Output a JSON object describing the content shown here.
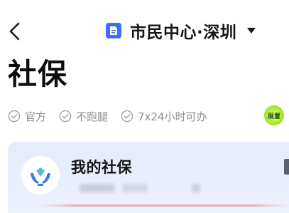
{
  "header": {
    "back_icon": "chevron-left-icon",
    "location_icon": "citizen-center-doc-icon",
    "location_label": "市民中心·深圳",
    "dropdown_icon": "caret-down-icon"
  },
  "page": {
    "title": "社保"
  },
  "features": [
    {
      "icon": "check-circle-icon",
      "label": "官方"
    },
    {
      "icon": "check-circle-icon",
      "label": "不跑腿"
    },
    {
      "icon": "check-circle-icon",
      "label": "7x24小时可办"
    }
  ],
  "badge": {
    "label": "展置"
  },
  "card": {
    "icon": "hands-heart-icon",
    "title": "我的社保"
  },
  "colors": {
    "brand_blue": "#3b6ff5",
    "feature_gray": "#8f8f8f",
    "card_bg": "#e4ebfb",
    "badge_green": "#9ce83a"
  }
}
